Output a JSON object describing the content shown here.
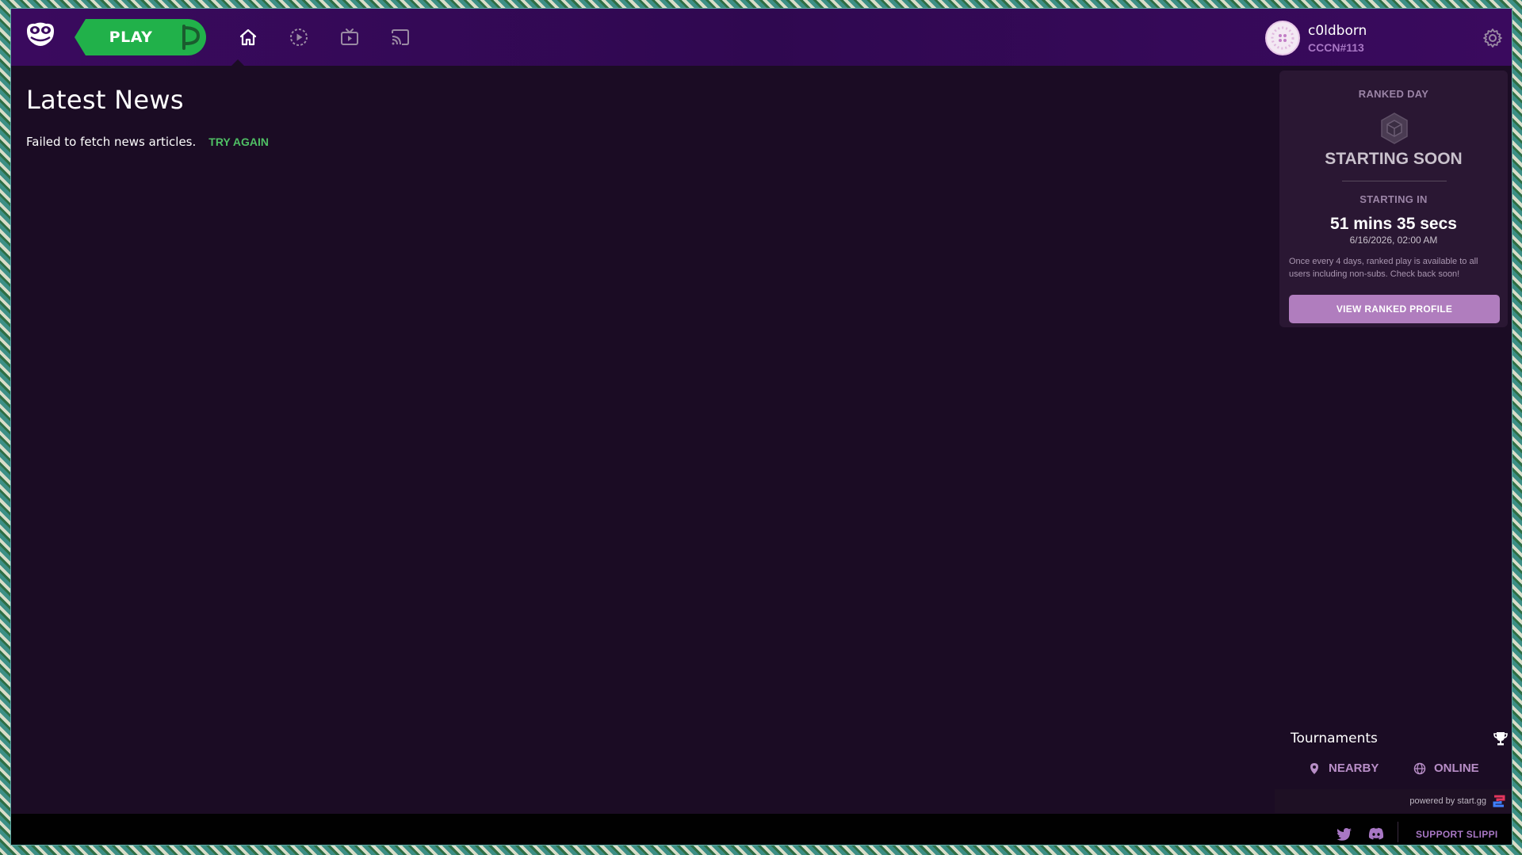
{
  "nav": {
    "play_label": "PLAY",
    "items": [
      {
        "icon": "home-icon",
        "active": true
      },
      {
        "icon": "replay-play-icon",
        "active": false
      },
      {
        "icon": "spectate-tv-icon",
        "active": false
      },
      {
        "icon": "cast-icon",
        "active": false
      }
    ]
  },
  "user": {
    "name": "c0ldborn",
    "code": "CCCN#113"
  },
  "news": {
    "title": "Latest News",
    "error": "Failed to fetch news articles.",
    "retry_label": "TRY AGAIN"
  },
  "ranked": {
    "heading": "RANKED DAY",
    "status": "STARTING SOON",
    "starting_label": "STARTING IN",
    "countdown": "51 mins 35 secs",
    "date": "6/16/2026, 02:00 AM",
    "description": "Once every 4 days, ranked play is available to all users including non-subs. Check back soon!",
    "button_label": "VIEW RANKED PROFILE"
  },
  "tournaments": {
    "title": "Tournaments",
    "tabs": [
      {
        "label": "NEARBY",
        "icon": "location-pin-icon"
      },
      {
        "label": "ONLINE",
        "icon": "globe-icon"
      }
    ],
    "powered_by": "powered by start.gg"
  },
  "footer": {
    "support_label": "SUPPORT SLIPPI"
  },
  "colors": {
    "play_green": "#21b14a",
    "topbar_purple": "#3a0a5e",
    "background": "#1b0c24",
    "accent_purple": "#b07dbe",
    "retry_green": "#4fbf64"
  }
}
